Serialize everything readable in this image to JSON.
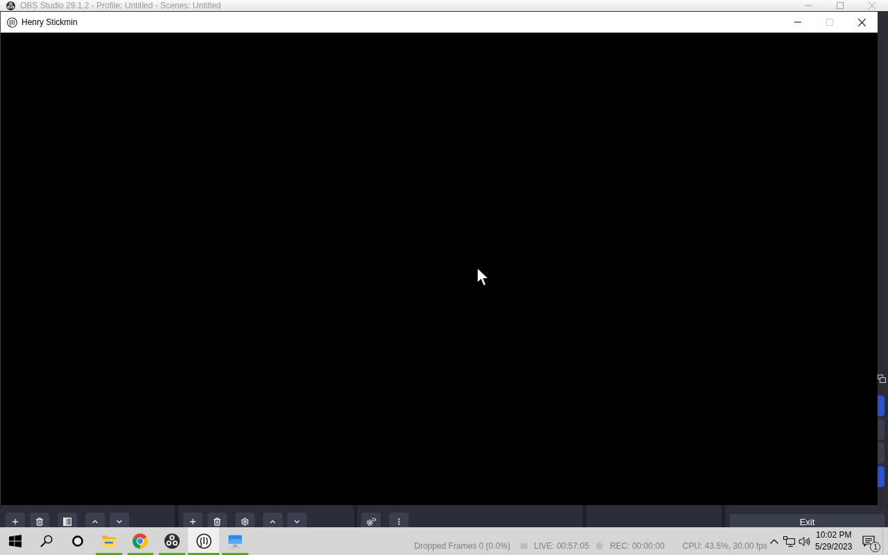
{
  "obs_window": {
    "title": "OBS Studio 29.1.2 - Profile: Untitled - Scenes: Untitled",
    "controls_dock": [
      {
        "checked": true
      },
      {
        "checked": false
      },
      {
        "checked": false
      },
      {
        "checked": true
      }
    ],
    "scenes_toolbar": [
      [
        {
          "kind": "add"
        },
        {
          "kind": "remove"
        }
      ],
      [
        {
          "kind": "filter"
        }
      ],
      [
        {
          "kind": "up"
        },
        {
          "kind": "down"
        }
      ]
    ],
    "sources_toolbar": [
      [
        {
          "kind": "add"
        },
        {
          "kind": "remove"
        }
      ],
      [
        {
          "kind": "properties"
        }
      ],
      [
        {
          "kind": "up"
        },
        {
          "kind": "down"
        }
      ]
    ],
    "mixer_toolbar": [
      [
        {
          "kind": "advanced"
        }
      ],
      [
        {
          "kind": "menu"
        }
      ]
    ],
    "exit_button": "Exit",
    "status_bar": {
      "dropped_frames": "Dropped Frames 0 (0.0%)",
      "live": "LIVE: 00:57:05",
      "rec": "REC: 00:00:00",
      "cpu": "CPU: 43.5%, 30.00 fps"
    }
  },
  "game_window": {
    "title": "Henry Stickmin",
    "maximize_disabled": true
  },
  "taskbar": {
    "items": [
      {
        "kind": "start",
        "running": false,
        "selected": false
      },
      {
        "kind": "search",
        "running": false,
        "selected": false
      },
      {
        "kind": "assistant",
        "running": false,
        "selected": false
      },
      {
        "kind": "files",
        "running": true,
        "selected": false
      },
      {
        "kind": "browser",
        "running": true,
        "selected": false
      },
      {
        "kind": "obs",
        "running": true,
        "selected": false
      },
      {
        "kind": "game",
        "running": true,
        "selected": true
      },
      {
        "kind": "remote",
        "running": true,
        "selected": false
      }
    ],
    "time": "10:02 PM",
    "date": "5/29/2023",
    "notification_count": "1"
  }
}
